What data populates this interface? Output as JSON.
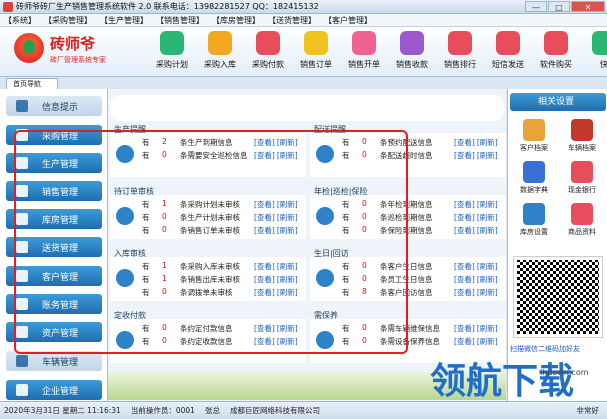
{
  "window": {
    "title": "砖师爷砖厂生产销售管理系统软件 2.0 联系电话：13982281527 QQ：182415132",
    "buttons": [
      "—",
      "□",
      "✕"
    ]
  },
  "menu": [
    "【系统】",
    "【采购管理】",
    "【生产管理】",
    "【销售管理】",
    "【库房管理】",
    "【送货管理】",
    "【客户管理】"
  ],
  "logo": {
    "title": "砖师爷",
    "subtitle": "砖厂管理系统专家"
  },
  "toolbar": [
    {
      "label": "采购计划",
      "color": "#2bb673",
      "icon": "box-icon"
    },
    {
      "label": "采购入库",
      "color": "#f2a81d",
      "icon": "pin-icon"
    },
    {
      "label": "采购付款",
      "color": "#e84d5b",
      "icon": "money-icon"
    },
    {
      "label": "销售订单",
      "color": "#f2c21d",
      "icon": "tv-icon"
    },
    {
      "label": "销售开单",
      "color": "#f06292",
      "icon": "u-icon"
    },
    {
      "label": "销售收款",
      "color": "#9b59d0",
      "icon": "play-icon"
    },
    {
      "label": "销售排行",
      "color": "#e84d5b",
      "icon": "bars-icon"
    },
    {
      "label": "短信发送",
      "color": "#e84d5b",
      "icon": "signal-icon"
    },
    {
      "label": "软件购买",
      "color": "#e84d5b",
      "icon": "location-icon"
    },
    {
      "label": "快",
      "color": "#2bb673",
      "icon": "more-icon"
    }
  ],
  "tab": "首页导航",
  "sidebar": [
    {
      "label": "信息提示",
      "style": "light"
    },
    {
      "label": "采购管理",
      "style": "blue"
    },
    {
      "label": "生产管理",
      "style": "blue"
    },
    {
      "label": "销售管理",
      "style": "blue"
    },
    {
      "label": "库房管理",
      "style": "blue"
    },
    {
      "label": "送货管理",
      "style": "blue"
    },
    {
      "label": "客户管理",
      "style": "blue"
    },
    {
      "label": "账务管理",
      "style": "blue"
    },
    {
      "label": "资产管理",
      "style": "blue"
    },
    {
      "label": "车辆管理",
      "style": "light"
    },
    {
      "label": "企业管理",
      "style": "blue"
    }
  ],
  "sections": [
    {
      "title": "生产提醒",
      "rows": [
        {
          "you": "有",
          "num": "2",
          "text": "条生产到期信息"
        },
        {
          "you": "有",
          "num": "0",
          "text": "条需要安全巡检信息"
        }
      ]
    },
    {
      "title": "配送提醒",
      "rows": [
        {
          "you": "有",
          "num": "0",
          "text": "条预约配送信息"
        },
        {
          "you": "有",
          "num": "0",
          "text": "条配送超时信息"
        }
      ]
    },
    {
      "title": "待订单审核",
      "rows": [
        {
          "you": "有",
          "num": "1",
          "text": "条采购计划未审核"
        },
        {
          "you": "有",
          "num": "0",
          "text": "条生产计划未审核"
        },
        {
          "you": "有",
          "num": "0",
          "text": "条销售订单未审核"
        }
      ]
    },
    {
      "title": "年检|巡检|保险",
      "rows": [
        {
          "you": "有",
          "num": "0",
          "text": "条年检到期信息"
        },
        {
          "you": "有",
          "num": "0",
          "text": "条巡检到期信息"
        },
        {
          "you": "有",
          "num": "0",
          "text": "条保险到期信息"
        }
      ]
    },
    {
      "title": "入库审核",
      "rows": [
        {
          "you": "有",
          "num": "1",
          "text": "条采购入库未审核"
        },
        {
          "you": "有",
          "num": "1",
          "text": "条销售出库未审核"
        },
        {
          "you": "有",
          "num": "0",
          "text": "条调拨单未审核"
        }
      ]
    },
    {
      "title": "生日|回访",
      "rows": [
        {
          "you": "有",
          "num": "0",
          "text": "条客户生日信息"
        },
        {
          "you": "有",
          "num": "0",
          "text": "条员工生日信息"
        },
        {
          "you": "有",
          "num": "8",
          "text": "条客户回访信息"
        }
      ]
    },
    {
      "title": "定收付款",
      "rows": [
        {
          "you": "有",
          "num": "0",
          "text": "条约定付款信息"
        },
        {
          "you": "有",
          "num": "0",
          "text": "条约定收款信息"
        }
      ]
    },
    {
      "title": "需保养",
      "rows": [
        {
          "you": "有",
          "num": "0",
          "text": "条需车辆维保信息"
        },
        {
          "you": "有",
          "num": "0",
          "text": "条需设备保养信息"
        }
      ]
    }
  ],
  "links": {
    "view": "[查看]",
    "refresh": "[刷新]"
  },
  "right_panel": {
    "header": "相关设置",
    "items": [
      {
        "label": "客户档案",
        "color": "#e8a33a",
        "icon": "people-icon"
      },
      {
        "label": "车辆档案",
        "color": "#c0392b",
        "icon": "truck-icon"
      },
      {
        "label": "数据字典",
        "color": "#3a6fd8",
        "icon": "book-icon"
      },
      {
        "label": "现金银行",
        "color": "#e84d5b",
        "icon": "bank-icon"
      },
      {
        "label": "库房设置",
        "color": "#2d82c9",
        "icon": "eye-icon"
      },
      {
        "label": "商品资料",
        "color": "#e84d5b",
        "icon": "goods-icon"
      }
    ],
    "qr_caption": "扫描微信二维码加好友"
  },
  "status": {
    "date": "2020年3月31日 星期二 11:16:31",
    "operator_label": "当前操作员：0001",
    "name": "张总",
    "company": "成都巨匠网络科技有限公司",
    "right": "非常好"
  },
  "watermark": {
    "text": "领航下载",
    "url": "lhdown.com"
  }
}
